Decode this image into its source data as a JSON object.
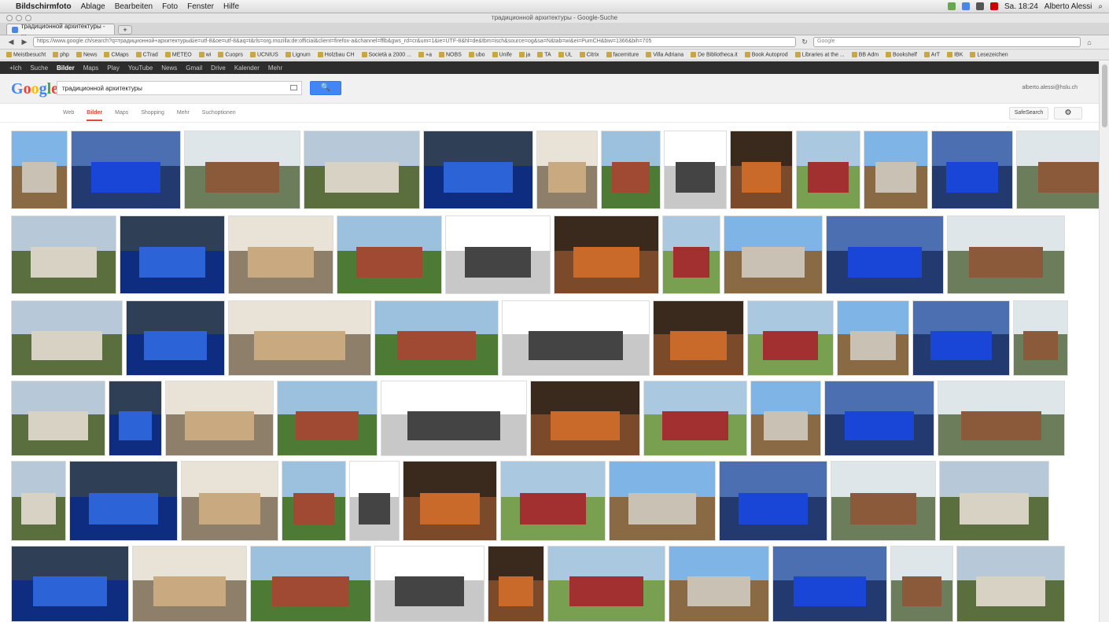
{
  "menubar": {
    "items": [
      "Bildschirmfoto",
      "Ablage",
      "Bearbeiten",
      "Foto",
      "Fenster",
      "Hilfe"
    ],
    "clock": "Sa. 18:24",
    "user": "Alberto Alessi"
  },
  "window": {
    "title": "традиционной архитектуры - Google-Suche"
  },
  "browser": {
    "tab_label": "традиционной архитектуры - ...",
    "new_tab": "+",
    "url": "https://www.google.ch/search?q=традиционной+архитектуры&ie=utf-8&oe=utf-8&aq=t&rls=org.mozilla:de:official&client=firefox-a&channel=fflb&gws_rd=cr&um=1&ie=UTF-8&hl=de&tbm=isch&source=og&sa=N&tab=wi&ei=PumCH&biw=1366&bih=705",
    "search_placeholder": "Google",
    "bookmarks": [
      "Meistbesucht",
      "php",
      "News",
      "CMaps",
      "CTrad",
      "METEO",
      "wi",
      "Cuoprs",
      "UCNIUS",
      "Lignum",
      "Holzbau CH",
      "Società a 2000 ...",
      "+a",
      "NOBS",
      "ubo",
      "Unife",
      "ja",
      "TA",
      "UL",
      "Citrix",
      "facemiture",
      "Villa Adriana",
      "De Bibliotheca.it",
      "Book Autoprod",
      "Libraries at the ...",
      "BB Adm",
      "Bookshelf",
      "ArT",
      "IBK",
      "Lesezeichen"
    ]
  },
  "google": {
    "topbar": [
      "+Ich",
      "Suche",
      "Bilder",
      "Maps",
      "Play",
      "YouTube",
      "News",
      "Gmail",
      "Drive",
      "Kalender",
      "Mehr"
    ],
    "topbar_active": "Bilder",
    "logo": "Google",
    "query": "традиционной архитектуры",
    "search_button": "🔍",
    "user_email": "alberto.alessi@hslu.ch",
    "subnav": [
      "Web",
      "Bilder",
      "Maps",
      "Shopping",
      "Mehr",
      "Suchoptionen"
    ],
    "subnav_active": "Bilder",
    "safesearch": "SafeSearch",
    "settings_icon": "gear-icon"
  }
}
